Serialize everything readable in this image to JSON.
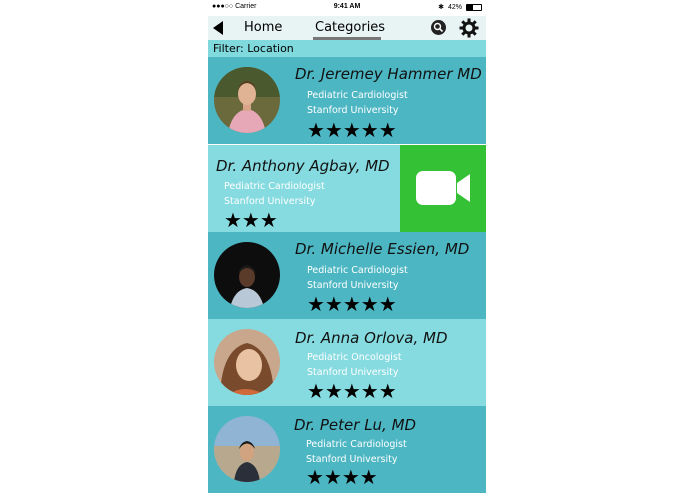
{
  "status_bar": {
    "carrier": "●●●○○ Carrier",
    "time": "9:41 AM",
    "battery": "42%",
    "battery_level": 0.42
  },
  "nav": {
    "back_label": "",
    "home": "Home",
    "categories": "Categories"
  },
  "filter": {
    "label": "Filter: Location"
  },
  "doctors": [
    {
      "name": "Dr. Jeremey Hammer MD",
      "specialty": "Pediatric Cardiologist",
      "school": "Stanford University",
      "rating": 5,
      "stars": "★★★★★"
    },
    {
      "name": "Dr. Anthony Agbay, MD",
      "specialty": "Pediatric Cardiologist",
      "school": "Stanford University",
      "rating": 3,
      "stars": "★★★"
    },
    {
      "name": "Dr. Michelle Essien, MD",
      "specialty": "Pediatric Cardiologist",
      "school": "Stanford University",
      "rating": 5,
      "stars": "★★★★★"
    },
    {
      "name": "Dr. Anna Orlova, MD",
      "specialty": "Pediatric Oncologist",
      "school": "Stanford University",
      "rating": 5,
      "stars": "★★★★★"
    },
    {
      "name": "Dr. Peter Lu, MD",
      "specialty": "Pediatric Cardiologist",
      "school": "Stanford University",
      "rating": 4,
      "stars": "★★★★"
    }
  ],
  "colors": {
    "card_dark": "#4db6c3",
    "card_light": "#86dbe0",
    "video_green": "#35c135",
    "filter_bar": "#7fd9dd"
  },
  "icons": {
    "back": "back-arrow-icon",
    "search": "search-icon",
    "settings": "gear-icon",
    "video": "video-camera-icon"
  }
}
